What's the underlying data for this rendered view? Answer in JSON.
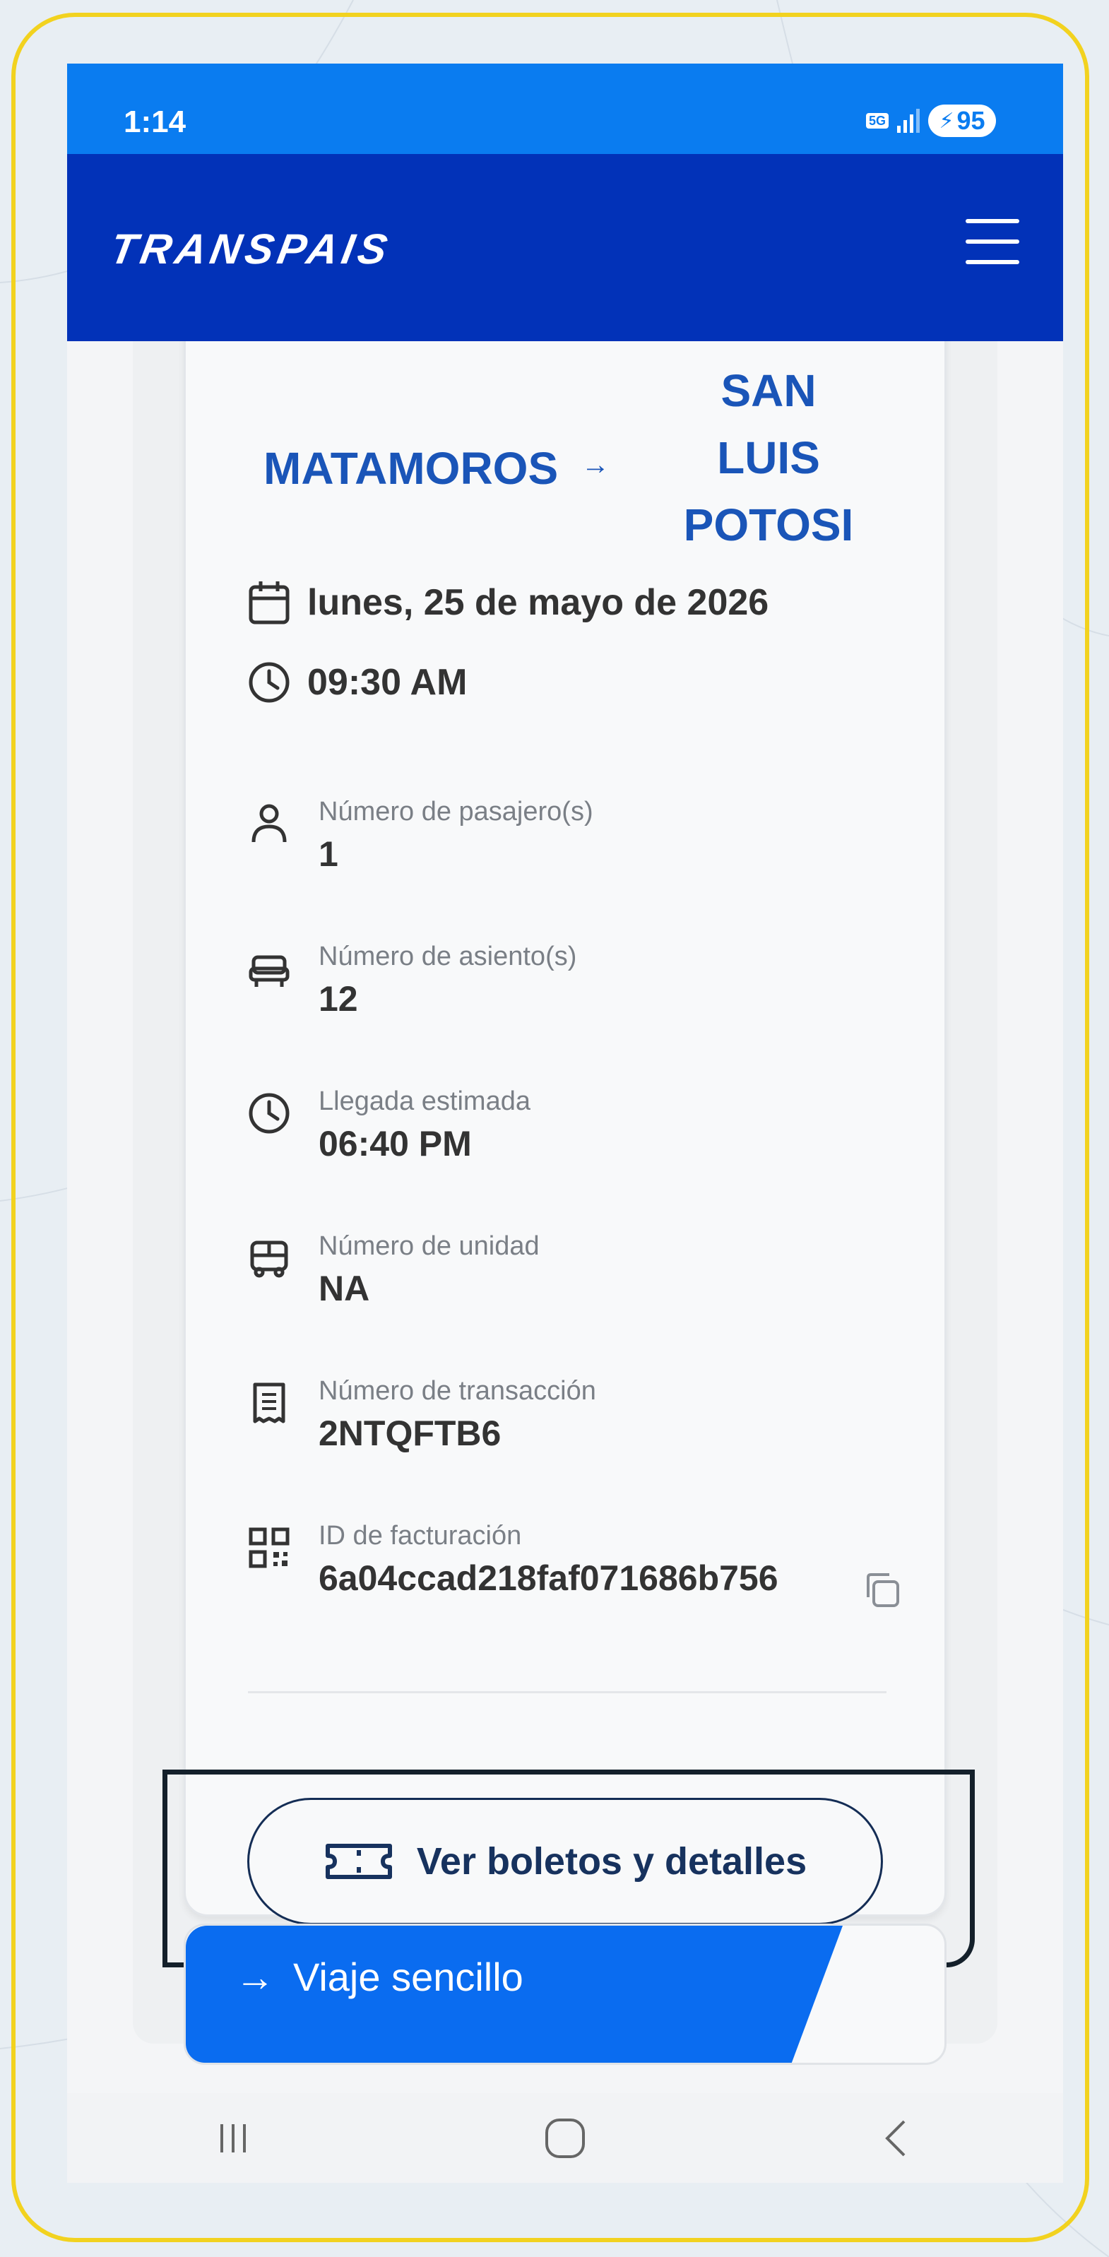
{
  "status_bar": {
    "time": "1:14",
    "network": "5G",
    "battery": "95",
    "background": "#0a7cf0"
  },
  "app_bar": {
    "logo_text": "TRANSPAIS",
    "brand_color": "#0232b8",
    "menu_icon": "hamburger-menu-icon"
  },
  "trip": {
    "origin": "MATAMOROS",
    "arrow": "→",
    "destination": "SAN LUIS POTOSI",
    "date": "lunes, 25 de mayo de 2026",
    "departure_time": "09:30 AM",
    "accent_color": "#1a55b8"
  },
  "details": [
    {
      "icon": "person-icon",
      "label": "Número de pasajero(s)",
      "value": "1"
    },
    {
      "icon": "seat-icon",
      "label": "Número de asiento(s)",
      "value": "12"
    },
    {
      "icon": "clock-icon",
      "label": "Llegada estimada",
      "value": "06:40 PM"
    },
    {
      "icon": "bus-icon",
      "label": "Número de unidad",
      "value": "NA"
    },
    {
      "icon": "receipt-icon",
      "label": "Número de transacción",
      "value": "2NTQFTB6"
    },
    {
      "icon": "qr-code-icon",
      "label": "ID de facturación",
      "value": "6a04ccad218faf071686b756"
    }
  ],
  "actions": {
    "view_tickets_label": "Ver boletos y detalles"
  },
  "next_card": {
    "label": "Viaje sencillo",
    "banner_color": "#0a6cf0"
  }
}
